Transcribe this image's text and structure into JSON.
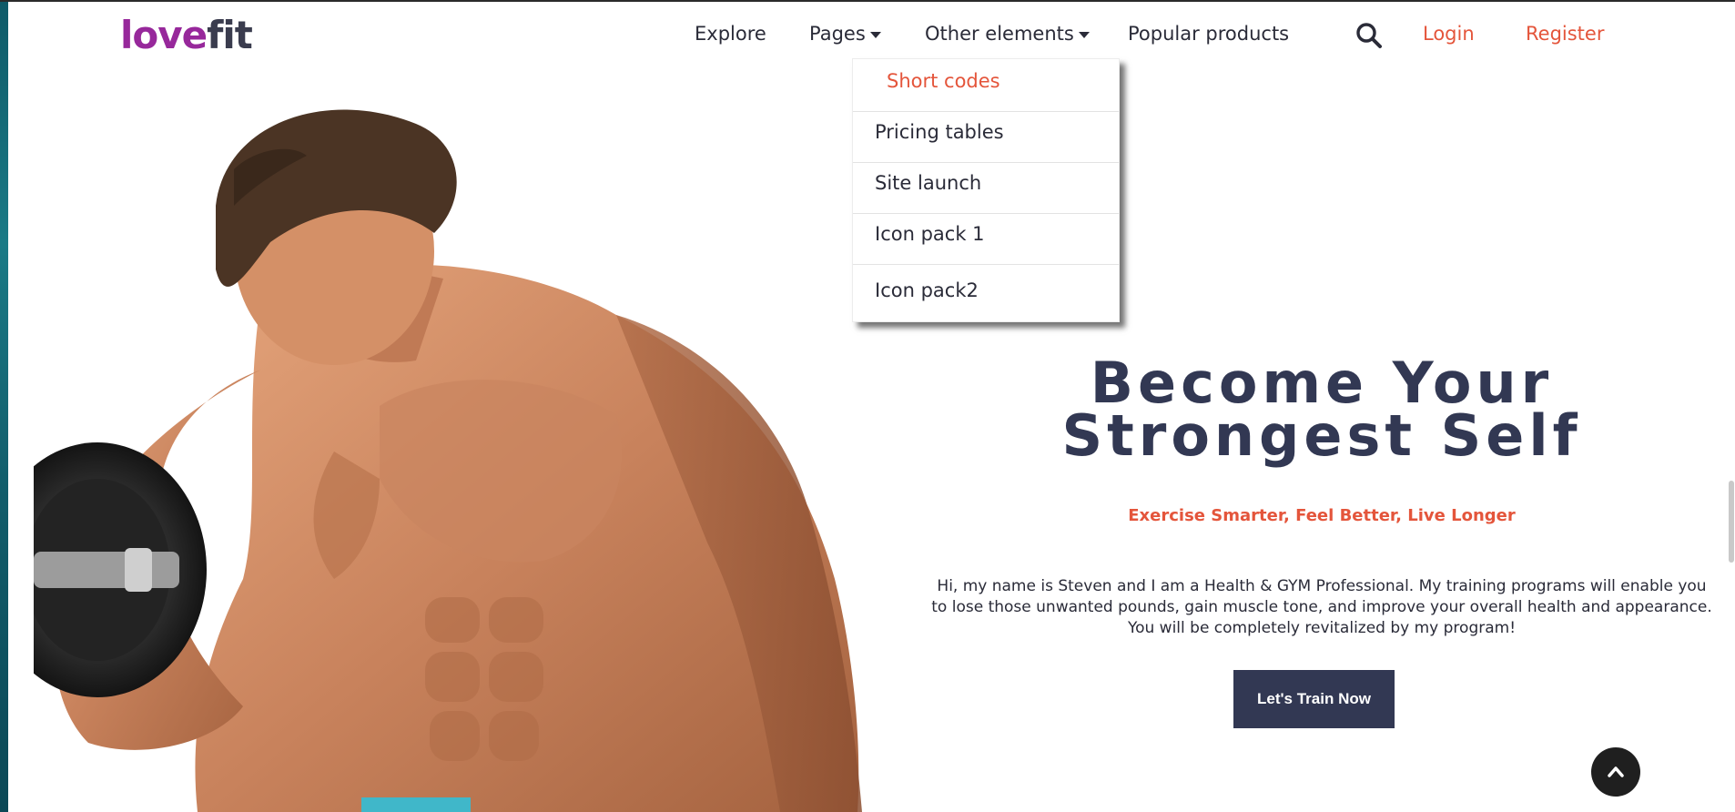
{
  "brand": {
    "logo_part1": "love",
    "logo_part2": "fit",
    "logo_color1": "#97289b",
    "logo_color2": "#3a3c4e"
  },
  "nav": {
    "explore": "Explore",
    "pages": "Pages",
    "other_elements": "Other elements",
    "popular_products": "Popular products",
    "search_icon": "search-icon",
    "login": "Login",
    "register": "Register"
  },
  "dropdown": {
    "items": [
      {
        "label": "Short codes"
      },
      {
        "label": "Pricing tables"
      },
      {
        "label": "Site launch"
      },
      {
        "label": "Icon pack 1"
      },
      {
        "label": "Icon pack2"
      }
    ]
  },
  "hero": {
    "title": "Become Your Strongest Self",
    "subtitle": "Exercise Smarter, Feel Better, Live Longer",
    "body": "Hi, my name is Steven and I am a Health & GYM Professional. My training programs will enable you to lose those unwanted pounds, gain muscle tone, and improve your overall health and appearance. You will be completely revitalized by my program!",
    "cta": "Let's Train Now"
  },
  "colors": {
    "accent": "#e4553b",
    "navy": "#323853",
    "text": "#2a2b38"
  }
}
